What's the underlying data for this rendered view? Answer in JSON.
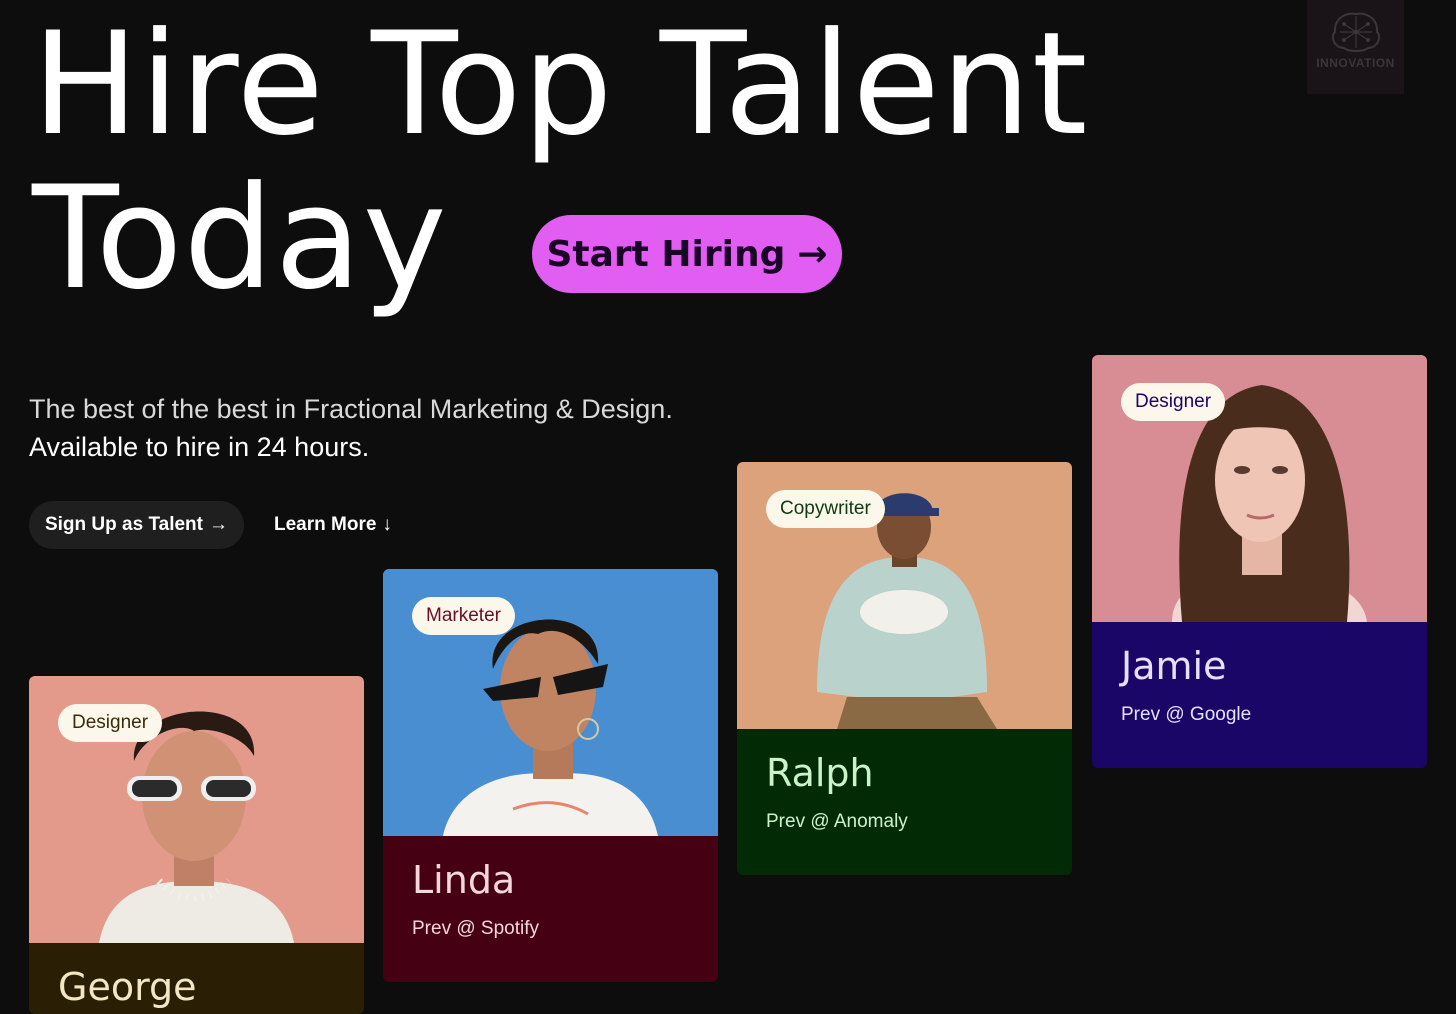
{
  "hero": {
    "line1": "Hire Top Talent",
    "line2": "Today",
    "cta_label": "Start Hiring",
    "cta_arrow": "→"
  },
  "logo": {
    "text": "INNOVATION"
  },
  "tagline": {
    "line1": "The best of the best in Fractional Marketing & Design.",
    "line2": "Available to hire in 24 hours."
  },
  "actions": {
    "signup_label": "Sign Up as Talent",
    "signup_arrow": "→",
    "learn_label": "Learn More",
    "learn_arrow": "↓"
  },
  "cards": [
    {
      "role": "Designer",
      "name": "George",
      "prev": "",
      "info_bg": "#2a1f05",
      "text_color": "#f3e6c4",
      "badge_color": "#3b2d0a",
      "photo_bg": "#e39a8a"
    },
    {
      "role": "Marketer",
      "name": "Linda",
      "prev": "Prev @ Spotify",
      "info_bg": "#460013",
      "text_color": "#f5d6dc",
      "badge_color": "#6a0d26",
      "photo_bg": "#4a8ed2"
    },
    {
      "role": "Copywriter",
      "name": "Ralph",
      "prev": "Prev @ Anomaly",
      "info_bg": "#022a05",
      "text_color": "#c9f3c9",
      "badge_color": "#0f3a12",
      "photo_bg": "#dba27c"
    },
    {
      "role": "Designer",
      "name": "Jamie",
      "prev": "Prev @ Google",
      "info_bg": "#1a0666",
      "text_color": "#e6e1ff",
      "badge_color": "#1a0666",
      "photo_bg": "#d88c93"
    }
  ]
}
